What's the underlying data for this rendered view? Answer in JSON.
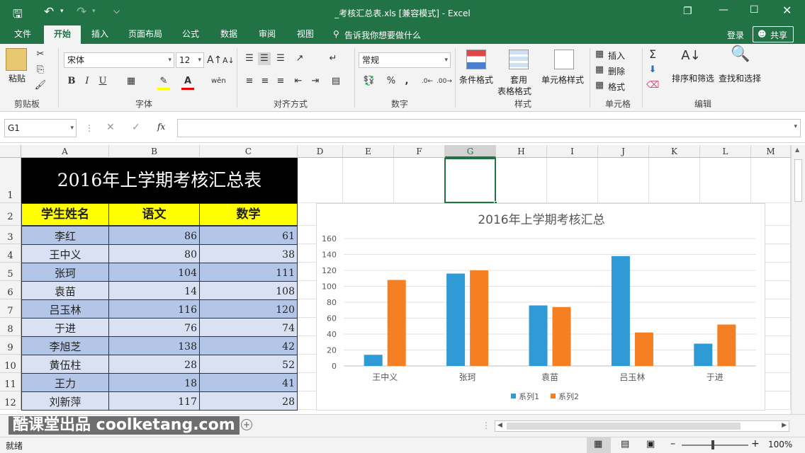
{
  "titlebar": {
    "title": "_考核汇总表.xls  [兼容模式] - Excel"
  },
  "menu": {
    "tabs": [
      "文件",
      "开始",
      "插入",
      "页面布局",
      "公式",
      "数据",
      "审阅",
      "视图"
    ],
    "tell_me": "告诉我你想要做什么",
    "login": "登录",
    "share": "共享"
  },
  "ribbon": {
    "clipboard": {
      "paste": "粘贴",
      "label": "剪贴板"
    },
    "font": {
      "name": "宋体",
      "size": "12",
      "label": "字体",
      "bold": "B",
      "italic": "I",
      "underline": "U"
    },
    "alignment": {
      "label": "对齐方式"
    },
    "number": {
      "format": "常规",
      "label": "数字",
      "percent": "%",
      "comma": ","
    },
    "styles": {
      "conditional": "条件格式",
      "table": "套用\n表格格式",
      "table_line1": "套用",
      "table_line2": "表格格式",
      "cell_styles": "单元格样式",
      "label": "样式"
    },
    "cells": {
      "insert": "插入",
      "delete": "删除",
      "format": "格式",
      "label": "单元格"
    },
    "editing": {
      "sort": "排序和筛选",
      "find": "查找和选择",
      "label": "编辑"
    }
  },
  "formula_bar": {
    "name_box": "G1",
    "fx": "fx",
    "value": ""
  },
  "columns": [
    "A",
    "B",
    "C",
    "D",
    "E",
    "F",
    "G",
    "H",
    "I",
    "J",
    "K",
    "L",
    "M"
  ],
  "rows": [
    "1",
    "2",
    "3",
    "4",
    "5",
    "6",
    "7",
    "8",
    "9",
    "10",
    "11",
    "12"
  ],
  "sheet": {
    "title": "2016年上学期考核汇总表",
    "headers": [
      "学生姓名",
      "语文",
      "数学"
    ],
    "records": [
      {
        "name": "李红",
        "chinese": "86",
        "math": "61"
      },
      {
        "name": "王中义",
        "chinese": "80",
        "math": "38"
      },
      {
        "name": "张珂",
        "chinese": "104",
        "math": "111"
      },
      {
        "name": "袁苗",
        "chinese": "14",
        "math": "108"
      },
      {
        "name": "吕玉林",
        "chinese": "116",
        "math": "120"
      },
      {
        "name": "于进",
        "chinese": "76",
        "math": "74"
      },
      {
        "name": "李旭芝",
        "chinese": "138",
        "math": "42"
      },
      {
        "name": "黄伍柱",
        "chinese": "28",
        "math": "52"
      },
      {
        "name": "王力",
        "chinese": "18",
        "math": "41"
      },
      {
        "name": "刘新萍",
        "chinese": "117",
        "math": "28"
      }
    ]
  },
  "chart_data": {
    "type": "bar",
    "title": "2016年上学期考核汇总",
    "categories": [
      "王中义",
      "张珂",
      "袁苗",
      "吕玉林",
      "于进"
    ],
    "series": [
      {
        "name": "系列1",
        "values": [
          14,
          116,
          76,
          138,
          28
        ],
        "color": "#2e9bd6"
      },
      {
        "name": "系列2",
        "values": [
          108,
          120,
          74,
          42,
          52
        ],
        "color": "#f58024"
      }
    ],
    "yticks": [
      "0",
      "20",
      "40",
      "60",
      "80",
      "100",
      "120",
      "140",
      "160"
    ],
    "ylim": [
      0,
      160
    ],
    "grid": true,
    "legend": "bottom"
  },
  "watermark": "酷课堂出品 coolketang.com",
  "status": {
    "ready": "就绪",
    "zoom": "100%"
  },
  "colors": {
    "accent": "#217346",
    "title_bg": "#000000",
    "header_bg": "#ffff00",
    "row_a": "#b4c6e7",
    "row_b": "#d9e1f2"
  }
}
